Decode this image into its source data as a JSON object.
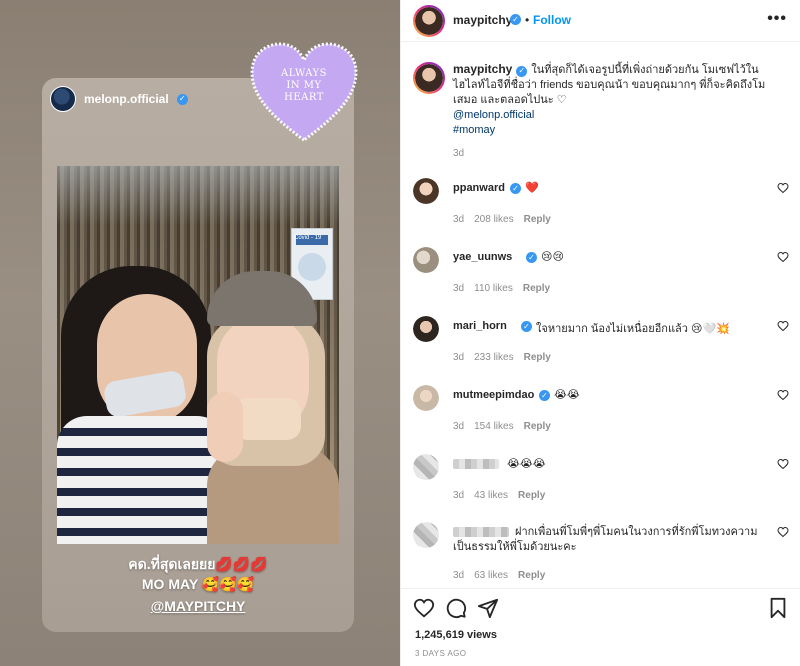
{
  "post": {
    "author": "maypitchy",
    "follow_label": "Follow",
    "separator": "•",
    "more_label": "•••",
    "caption_text": "ในที่สุดก็ได้เจอรูปนี้ที่เพิ่งถ่ายด้วยกัน โมเซฟไว้ในไฮไลท์ไอจีที่ชื่อว่า friends ขอบคุณน้า ขอบคุณมากๆ พี่ก็จะคิดถึงโมเสมอ และตลอดไปนะ ♡",
    "caption_mention": "@melonp.official",
    "caption_hashtag": "#momay",
    "caption_time": "3d",
    "views": "1,245,619 views",
    "date": "3 DAYS AGO"
  },
  "story": {
    "username": "melonp.official",
    "heart_line1": "ALWAYS",
    "heart_line2": "IN MY",
    "heart_line3": "HEART",
    "caption_line1": "คด.ที่สุดเลยยย💋💋💋",
    "caption_line2": "MO MAY 🥰🥰🥰",
    "caption_line3": "@MAYPITCHY",
    "sign_text": "Covid - 19"
  },
  "comments": [
    {
      "user": "ppanward",
      "text": "❤️",
      "time": "3d",
      "likes": "208 likes",
      "reply": "Reply"
    },
    {
      "user": "yae_uunws",
      "text": "😢😢",
      "time": "3d",
      "likes": "110 likes",
      "reply": "Reply"
    },
    {
      "user": "mari_horn",
      "text": "ใจหายมาก น้องไม่เหนื่อยอีกแล้ว 😢🤍💥",
      "time": "3d",
      "likes": "233 likes",
      "reply": "Reply"
    },
    {
      "user": "mutmeepimdao",
      "text": "😭😭",
      "time": "3d",
      "likes": "154 likes",
      "reply": "Reply"
    },
    {
      "user": "",
      "text": "😭😭😭",
      "time": "3d",
      "likes": "43 likes",
      "reply": "Reply"
    },
    {
      "user": "",
      "text": "ฝากเพื่อนพี่โมพี่ๆพี่โมคนในวงการที่รักพี่โมทวงความเป็นธรรมให้พี่โมด้วยนะคะ",
      "time": "3d",
      "likes": "63 likes",
      "reply": "Reply"
    }
  ],
  "colors": {
    "accent": "#0095f6",
    "verified": "#3897f0",
    "heart_red": "#ed4956",
    "muted": "#8e8e8e",
    "story_heart": "#c4a9f2"
  },
  "icons": [
    "heart-icon",
    "comment-icon",
    "share-icon",
    "bookmark-icon",
    "verified-icon",
    "more-icon"
  ]
}
